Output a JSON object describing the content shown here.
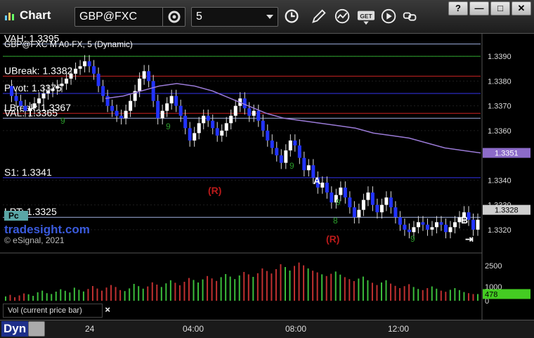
{
  "toolbar": {
    "title": "Chart",
    "symbol": "GBP@FXC",
    "interval": "5",
    "window_buttons": [
      "?",
      "—",
      "□",
      "✕"
    ]
  },
  "chart_data": [
    {
      "type": "candlestick",
      "title": "GBP@FXC M A0-FX, 5 (Dynamic)",
      "y_axis_ticks": [
        "1.3390",
        "1.3380",
        "1.3370",
        "1.3360",
        "1.3340",
        "1.3330",
        "1.3320"
      ],
      "ylim": [
        1.3312,
        1.3398
      ],
      "x_axis_ticks": [
        "24",
        "04:00",
        "08:00",
        "12:00"
      ],
      "price_badges": [
        {
          "value": "1.3351",
          "color": "#8c6bc9"
        },
        {
          "value": "1.3328",
          "color": "#cfcfcf"
        }
      ],
      "levels": [
        {
          "label": "VAH: 1.3395",
          "value": 1.3395,
          "color": "#9fb0e0"
        },
        {
          "label": "",
          "value": 1.339,
          "color": "#2fa82f"
        },
        {
          "label": "UBreak: 1.3382",
          "value": 1.3382,
          "color": "#cc2222"
        },
        {
          "label": "Pivot: 1.3375",
          "value": 1.3375,
          "color": "#3333ee"
        },
        {
          "label": "LBreak: 1.3367",
          "value": 1.3367,
          "color": "#cc2222"
        },
        {
          "label": "VAL: 1.3365",
          "value": 1.3365,
          "color": "#9fb0e0"
        },
        {
          "label": "S1: 1.3341",
          "value": 1.3341,
          "color": "#3333ee"
        },
        {
          "label": "LPT: 1.3325",
          "value": 1.3325,
          "color": "#9fb0e0"
        }
      ],
      "markers": [
        {
          "text": "(R)",
          "color": "#bb1a1a"
        },
        {
          "text": "(R)",
          "color": "#bb1a1a"
        },
        {
          "text": "A",
          "color": "#ffffff"
        },
        {
          "text": "B",
          "color": "#ffffff"
        }
      ],
      "sequence_counts": [
        "9",
        "9",
        "9",
        "9",
        "8",
        "9"
      ],
      "watermark": {
        "brand": "tradesight.com",
        "copyright": "© eSignal, 2021"
      },
      "pc_label": "Pc",
      "series": [
        {
          "name": "price",
          "values": [
            1.3378,
            1.3374,
            1.3372,
            1.337,
            1.3368,
            1.3369,
            1.3371,
            1.3373,
            1.3375,
            1.3376,
            1.3377,
            1.3378,
            1.3379,
            1.3381,
            1.3383,
            1.3385,
            1.3386,
            1.3388,
            1.3386,
            1.3383,
            1.3378,
            1.3374,
            1.337,
            1.3368,
            1.3366,
            1.3365,
            1.3368,
            1.3372,
            1.3376,
            1.3381,
            1.3384,
            1.338,
            1.3372,
            1.3365,
            1.3368,
            1.3371,
            1.3374,
            1.337,
            1.3366,
            1.3361,
            1.3356,
            1.3359,
            1.3363,
            1.3366,
            1.3364,
            1.3361,
            1.3358,
            1.336,
            1.3363,
            1.3366,
            1.337,
            1.3373,
            1.3369,
            1.3366,
            1.3368,
            1.3364,
            1.336,
            1.3356,
            1.3353,
            1.335,
            1.3347,
            1.3352,
            1.3356,
            1.3354,
            1.3349,
            1.3344,
            1.3346,
            1.3341,
            1.3337,
            1.3339,
            1.3335,
            1.3331,
            1.3334,
            1.3337,
            1.3333,
            1.3329,
            1.3325,
            1.3328,
            1.3332,
            1.3335,
            1.333,
            1.3327,
            1.333,
            1.3333,
            1.3329,
            1.3325,
            1.3322,
            1.332,
            1.3319,
            1.3321,
            1.3323,
            1.3322,
            1.332,
            1.3321,
            1.3323,
            1.3322,
            1.3319,
            1.3321,
            1.3323,
            1.3325,
            1.3327,
            1.3324,
            1.332,
            1.3324
          ]
        },
        {
          "name": "",
          "values": [
            1.3373,
            1.3374,
            1.3376,
            1.3378,
            1.3379,
            1.3378,
            1.3376,
            1.3373,
            1.337,
            1.3367,
            1.3365,
            1.3364,
            1.3363,
            1.3362,
            1.3361,
            1.3359,
            1.3358,
            1.3357,
            1.3355,
            1.3353,
            1.3352,
            1.3351
          ]
        }
      ]
    },
    {
      "type": "bar",
      "title": "Vol (current price bar)",
      "y_axis_ticks": [
        "2500",
        "1000",
        "0"
      ],
      "ylim": [
        0,
        3200
      ],
      "current_value": "478",
      "series": [
        {
          "name": "Vol (current price bar)",
          "values": [
            310,
            420,
            250,
            380,
            520,
            460,
            350,
            600,
            720,
            540,
            480,
            650,
            820,
            710,
            590,
            930,
            780,
            660,
            840,
            1050,
            870,
            720,
            940,
            1120,
            980,
            760,
            690,
            880,
            1200,
            1040,
            860,
            1020,
            1310,
            1150,
            980,
            1240,
            1460,
            1280,
            1100,
            1350,
            1620,
            1480,
            1300,
            1520,
            1760,
            1590,
            1410,
            1680,
            1900,
            1720,
            1540,
            1800,
            2050,
            1880,
            1700,
            1960,
            2300,
            2120,
            1940,
            2250,
            2600,
            2400,
            2150,
            2480,
            2720,
            2520,
            2300,
            2140,
            2020,
            1880,
            1760,
            1920,
            2080,
            1860,
            1680,
            1540,
            1400,
            1580,
            1720,
            1460,
            1280,
            1120,
            1300,
            1460,
            1220,
            1060,
            900,
            1040,
            1180,
            980,
            840,
            760,
            900,
            1020,
            860,
            720,
            640,
            780,
            900,
            760,
            620,
            540,
            478,
            478
          ]
        }
      ]
    }
  ]
}
